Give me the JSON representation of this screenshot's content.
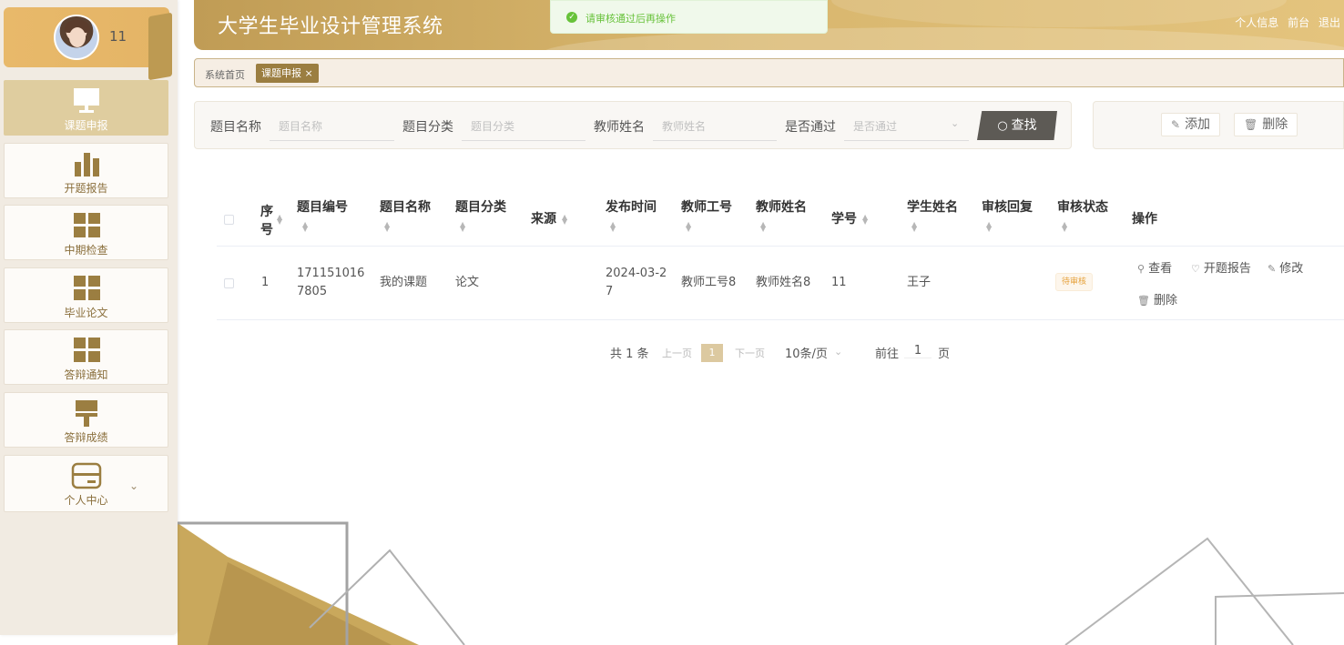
{
  "user": {
    "name": "11"
  },
  "sidebar": {
    "items": [
      {
        "label": "课题申报",
        "icon": "monitor-icon",
        "active": true
      },
      {
        "label": "开题报告",
        "icon": "bar-chart-icon",
        "active": false
      },
      {
        "label": "中期检查",
        "icon": "grid-icon",
        "active": false
      },
      {
        "label": "毕业论文",
        "icon": "grid-icon",
        "active": false
      },
      {
        "label": "答辩通知",
        "icon": "grid-icon",
        "active": false
      },
      {
        "label": "答辩成绩",
        "icon": "brush-icon",
        "active": false
      },
      {
        "label": "个人中心",
        "icon": "card-icon",
        "active": false
      }
    ]
  },
  "header": {
    "title": "大学生毕业设计管理系统",
    "links": {
      "profile": "个人信息",
      "front": "前台",
      "logout": "退出"
    }
  },
  "toast": {
    "message": "请审核通过后再操作",
    "color": "#67c23a"
  },
  "tags": {
    "home": "系统首页",
    "active": "课题申报 ×"
  },
  "search": {
    "fields": [
      {
        "label": "题目名称",
        "placeholder": "题目名称"
      },
      {
        "label": "题目分类",
        "placeholder": "题目分类"
      },
      {
        "label": "教师姓名",
        "placeholder": "教师姓名"
      },
      {
        "label": "是否通过",
        "placeholder": "是否通过"
      }
    ],
    "button": "查找"
  },
  "actions": {
    "add": "添加",
    "delete": "删除"
  },
  "table": {
    "headers": {
      "seq_line1": "序",
      "seq_line2": "号",
      "code": "题目编号",
      "name": "题目名称",
      "category": "题目分类",
      "source": "来源",
      "publish_time": "发布时间",
      "teacher_id": "教师工号",
      "teacher_name": "教师姓名",
      "student_no": "学号",
      "student_name": "学生姓名",
      "review_reply": "审核回复",
      "review_status": "审核状态",
      "operations": "操作"
    },
    "rows": [
      {
        "seq": "1",
        "code_line1": "171151016",
        "code_line2": "7805",
        "name": "我的课题",
        "category": "论文",
        "source": "",
        "time_line1": "2024-03-2",
        "time_line2": "7",
        "teacher_id": "教师工号8",
        "teacher_name": "教师姓名8",
        "student_no": "11",
        "student_name": "王子",
        "review_reply": "",
        "status": "待审核",
        "ops": {
          "view": "查看",
          "report": "开题报告",
          "edit": "修改",
          "delete": "删除"
        }
      }
    ]
  },
  "pagination": {
    "total": "共 1 条",
    "prev": "上一页",
    "current": "1",
    "next": "下一页",
    "page_size": "10条/页",
    "goto": "前往",
    "goto_value": "1",
    "page_unit": "页"
  },
  "colors": {
    "accent": "#c09c55",
    "active_menu": "#dfcd9f",
    "tag": "#9b7e41"
  }
}
